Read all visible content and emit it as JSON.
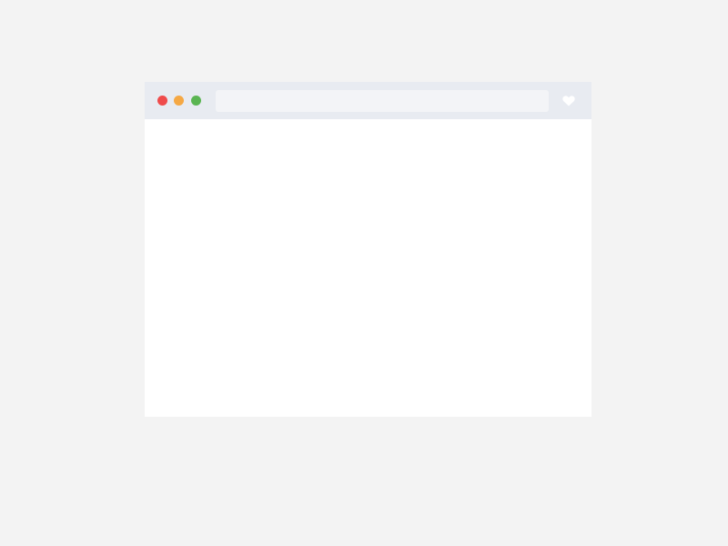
{
  "browser": {
    "address_bar": {
      "value": "",
      "placeholder": ""
    },
    "controls": {
      "close_color": "#ef4b4b",
      "minimize_color": "#f5a844",
      "maximize_color": "#5ab552"
    },
    "title_bar_color": "#e8ebf1",
    "favorite_icon": "heart-icon"
  },
  "content": {
    "text": ""
  }
}
